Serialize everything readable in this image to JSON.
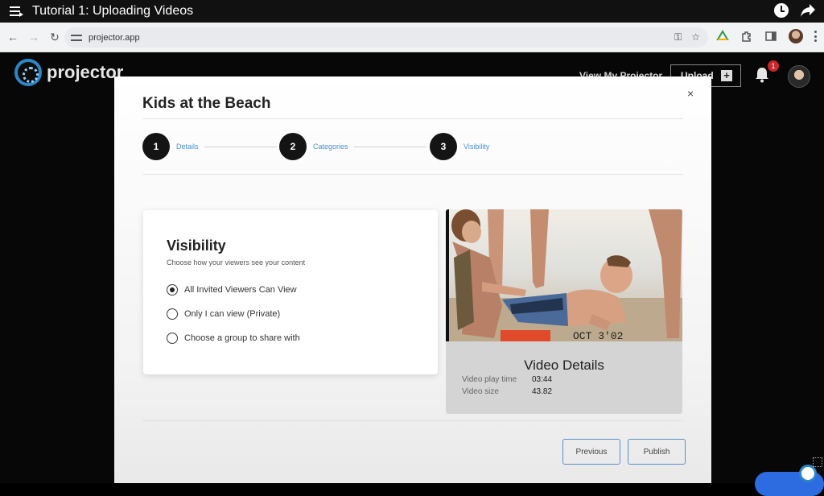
{
  "video_player": {
    "title": "Tutorial 1: Uploading Videos"
  },
  "browser": {
    "url": "projector.app"
  },
  "app": {
    "logo_text": "projector",
    "nav_link": "View My Projector",
    "upload_label": "Upload",
    "notification_count": "1"
  },
  "modal": {
    "title": "Kids at the Beach",
    "close": "×",
    "steps": [
      {
        "number": "1",
        "label": "Details"
      },
      {
        "number": "2",
        "label": "Categories"
      },
      {
        "number": "3",
        "label": "Visibility"
      }
    ],
    "visibility": {
      "title": "Visibility",
      "subtitle": "Choose how your viewers see your content",
      "options": [
        {
          "label": "All Invited Viewers Can View",
          "selected": true
        },
        {
          "label": "Only I can view (Private)",
          "selected": false
        },
        {
          "label": "Choose a group to share with",
          "selected": false
        }
      ]
    },
    "video_details": {
      "title": "Video Details",
      "play_time_label": "Video play time",
      "play_time_value": "03:44",
      "size_label": "Video size",
      "size_value": "43.82",
      "thumbnail_overlay": "ОСТ 3'02"
    },
    "buttons": {
      "previous": "Previous",
      "publish": "Publish"
    }
  },
  "colors": {
    "accent": "#4a90d9",
    "button_border": "#5d8fc9",
    "badge": "#c8262b",
    "logo_ring": "#2d86c8"
  }
}
